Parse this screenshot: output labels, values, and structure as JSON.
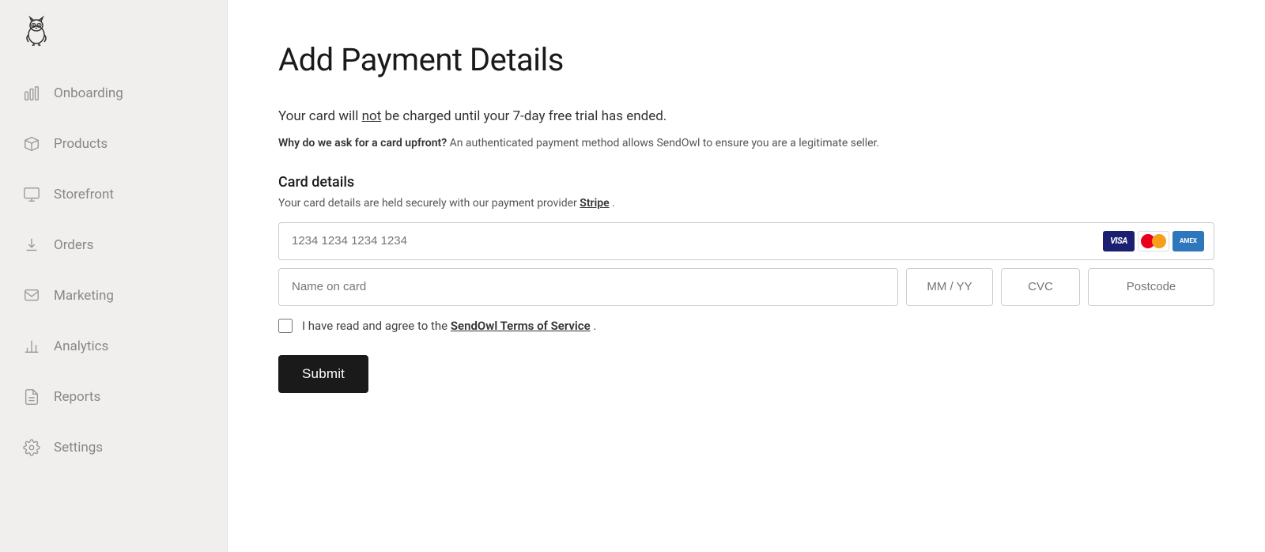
{
  "sidebar": {
    "logo_alt": "SendOwl Logo",
    "items": [
      {
        "id": "onboarding",
        "label": "Onboarding",
        "icon": "chart-bar-icon"
      },
      {
        "id": "products",
        "label": "Products",
        "icon": "box-icon"
      },
      {
        "id": "storefront",
        "label": "Storefront",
        "icon": "monitor-icon"
      },
      {
        "id": "orders",
        "label": "Orders",
        "icon": "download-icon"
      },
      {
        "id": "marketing",
        "label": "Marketing",
        "icon": "message-icon"
      },
      {
        "id": "analytics",
        "label": "Analytics",
        "icon": "bar-chart-icon"
      },
      {
        "id": "reports",
        "label": "Reports",
        "icon": "file-icon"
      },
      {
        "id": "settings",
        "label": "Settings",
        "icon": "gear-icon"
      }
    ]
  },
  "main": {
    "page_title": "Add Payment Details",
    "trial_notice": "Your card will",
    "trial_notice_not": "not",
    "trial_notice_after": "be charged until your 7-day free trial has ended.",
    "why_label": "Why do we ask for a card upfront?",
    "why_text": "An authenticated payment method allows SendOwl to ensure you are a legitimate seller.",
    "card_details_title": "Card details",
    "stripe_notice_pre": "Your card details are held securely with our payment provider",
    "stripe_link": "Stripe",
    "stripe_notice_post": ".",
    "card_number_placeholder": "1234 1234 1234 1234",
    "name_placeholder": "Name on card",
    "expiry_placeholder": "MM / YY",
    "cvc_placeholder": "CVC",
    "postcode_placeholder": "Postcode",
    "terms_pre": "I have read and agree to the",
    "terms_link": "SendOwl Terms of Service",
    "terms_post": ".",
    "submit_label": "Submit",
    "card_icons": {
      "visa": "VISA",
      "mastercard": "MC",
      "amex": "AMEX"
    }
  }
}
